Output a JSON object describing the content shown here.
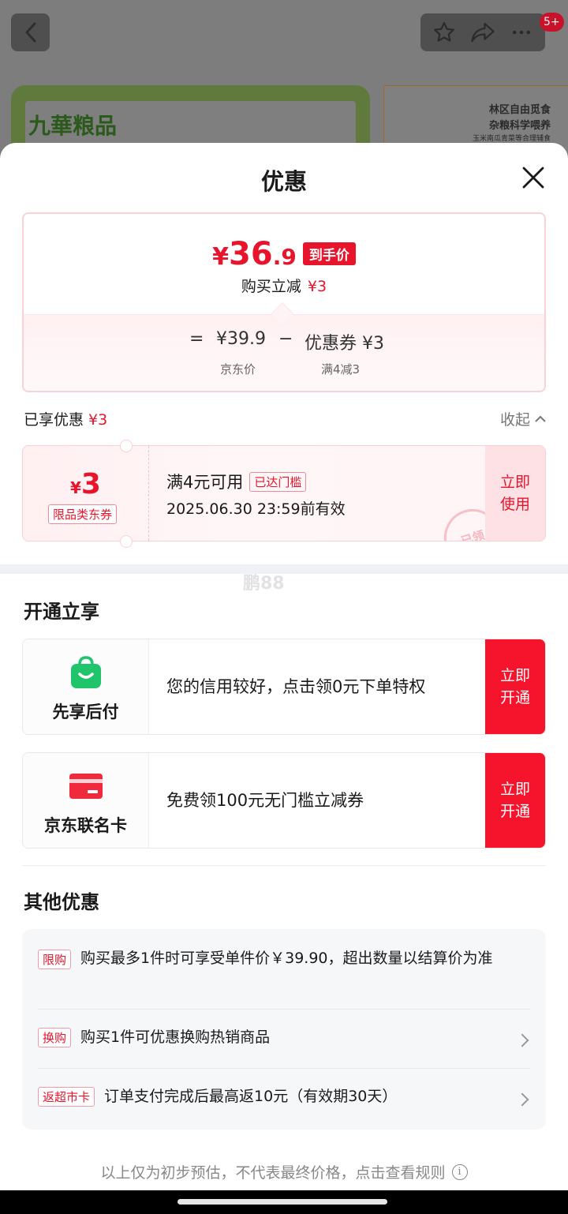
{
  "background": {
    "brand_logo_text": "九華粮品",
    "right_card_line1": "林区自由觅食",
    "right_card_line2": "杂粮科学喂养",
    "right_card_line3": "玉米南瓜青菜等合理辅食",
    "notification_badge": "5+"
  },
  "sheet": {
    "title": "优惠"
  },
  "price": {
    "yen": "¥",
    "integer": "36",
    "decimal": ".9",
    "tag": "到手价",
    "reduce_label": "购买立减",
    "reduce_amount": "¥3",
    "equals": "=",
    "base_price": "¥39.9",
    "minus": "−",
    "coupon_label": "优惠券 ¥3",
    "base_price_label": "京东价",
    "coupon_condition": "满4减3"
  },
  "enjoyed": {
    "label": "已享优惠",
    "amount": "¥3",
    "collapse_label": "收起"
  },
  "coupon": {
    "yen": "¥",
    "value": "3",
    "type": "限品类东券",
    "condition": "满4元可用",
    "met_badge": "已达门槛",
    "expiry": "2025.06.30 23:59前有效",
    "use_button": "立即使用",
    "stamp_text": "已领"
  },
  "watermark": "鹏88",
  "open_section": {
    "title": "开通立享",
    "cards": [
      {
        "name": "先享后付",
        "desc": "您的信用较好，点击领0元下单特权",
        "button": "立即开通"
      },
      {
        "name": "京东联名卡",
        "desc": "免费领100元无门槛立减券",
        "button": "立即开通"
      }
    ]
  },
  "other_section": {
    "title": "其他优惠",
    "items": [
      {
        "tag": "限购",
        "text": "购买最多1件时可享受单件价￥39.90，超出数量以结算价为准"
      },
      {
        "tag": "换购",
        "text": "购买1件可优惠换购热销商品"
      },
      {
        "tag": "返超市卡",
        "text": "订单支付完成后最高返10元（有效期30天）"
      }
    ]
  },
  "footer": {
    "note": "以上仅为初步预估，不代表最终价格，点击查看规则",
    "info_icon": "i"
  },
  "colors": {
    "accent_red": "#e8142c",
    "button_red": "#f5142c",
    "green_icon": "#22c55e"
  }
}
